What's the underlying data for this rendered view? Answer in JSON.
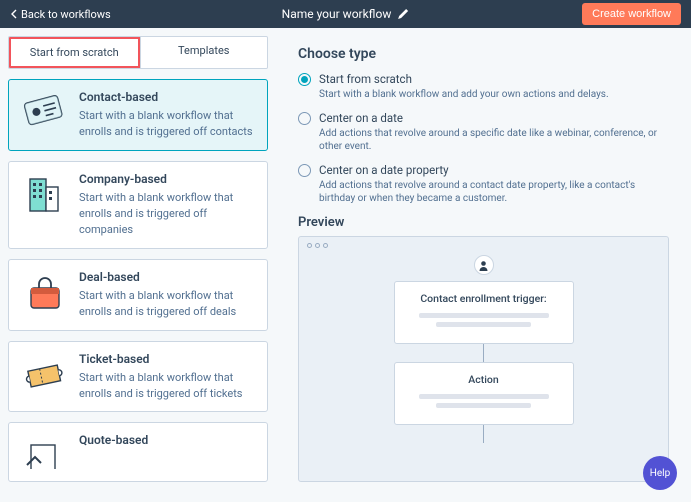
{
  "header": {
    "back_label": "Back to workflows",
    "title": "Name your workflow",
    "create_label": "Create workflow"
  },
  "tabs": {
    "scratch": "Start from scratch",
    "templates": "Templates"
  },
  "cards": {
    "contact": {
      "title": "Contact-based",
      "desc": "Start with a blank workflow that enrolls and is triggered off contacts"
    },
    "company": {
      "title": "Company-based",
      "desc": "Start with a blank workflow that enrolls and is triggered off companies"
    },
    "deal": {
      "title": "Deal-based",
      "desc": "Start with a blank workflow that enrolls and is triggered off deals"
    },
    "ticket": {
      "title": "Ticket-based",
      "desc": "Start with a blank workflow that enrolls and is triggered off tickets"
    },
    "quote": {
      "title": "Quote-based",
      "desc": ""
    }
  },
  "choose": {
    "heading": "Choose type",
    "opts": [
      {
        "label": "Start from scratch",
        "desc": "Start with a blank workflow and add your own actions and delays."
      },
      {
        "label": "Center on a date",
        "desc": "Add actions that revolve around a specific date like a webinar, conference, or other event."
      },
      {
        "label": "Center on a date property",
        "desc": "Add actions that revolve around a contact date property, like a contact's birthday or when they became a customer."
      }
    ]
  },
  "preview": {
    "heading": "Preview",
    "trigger_title": "Contact enrollment trigger:",
    "action_title": "Action"
  },
  "help": "Help"
}
